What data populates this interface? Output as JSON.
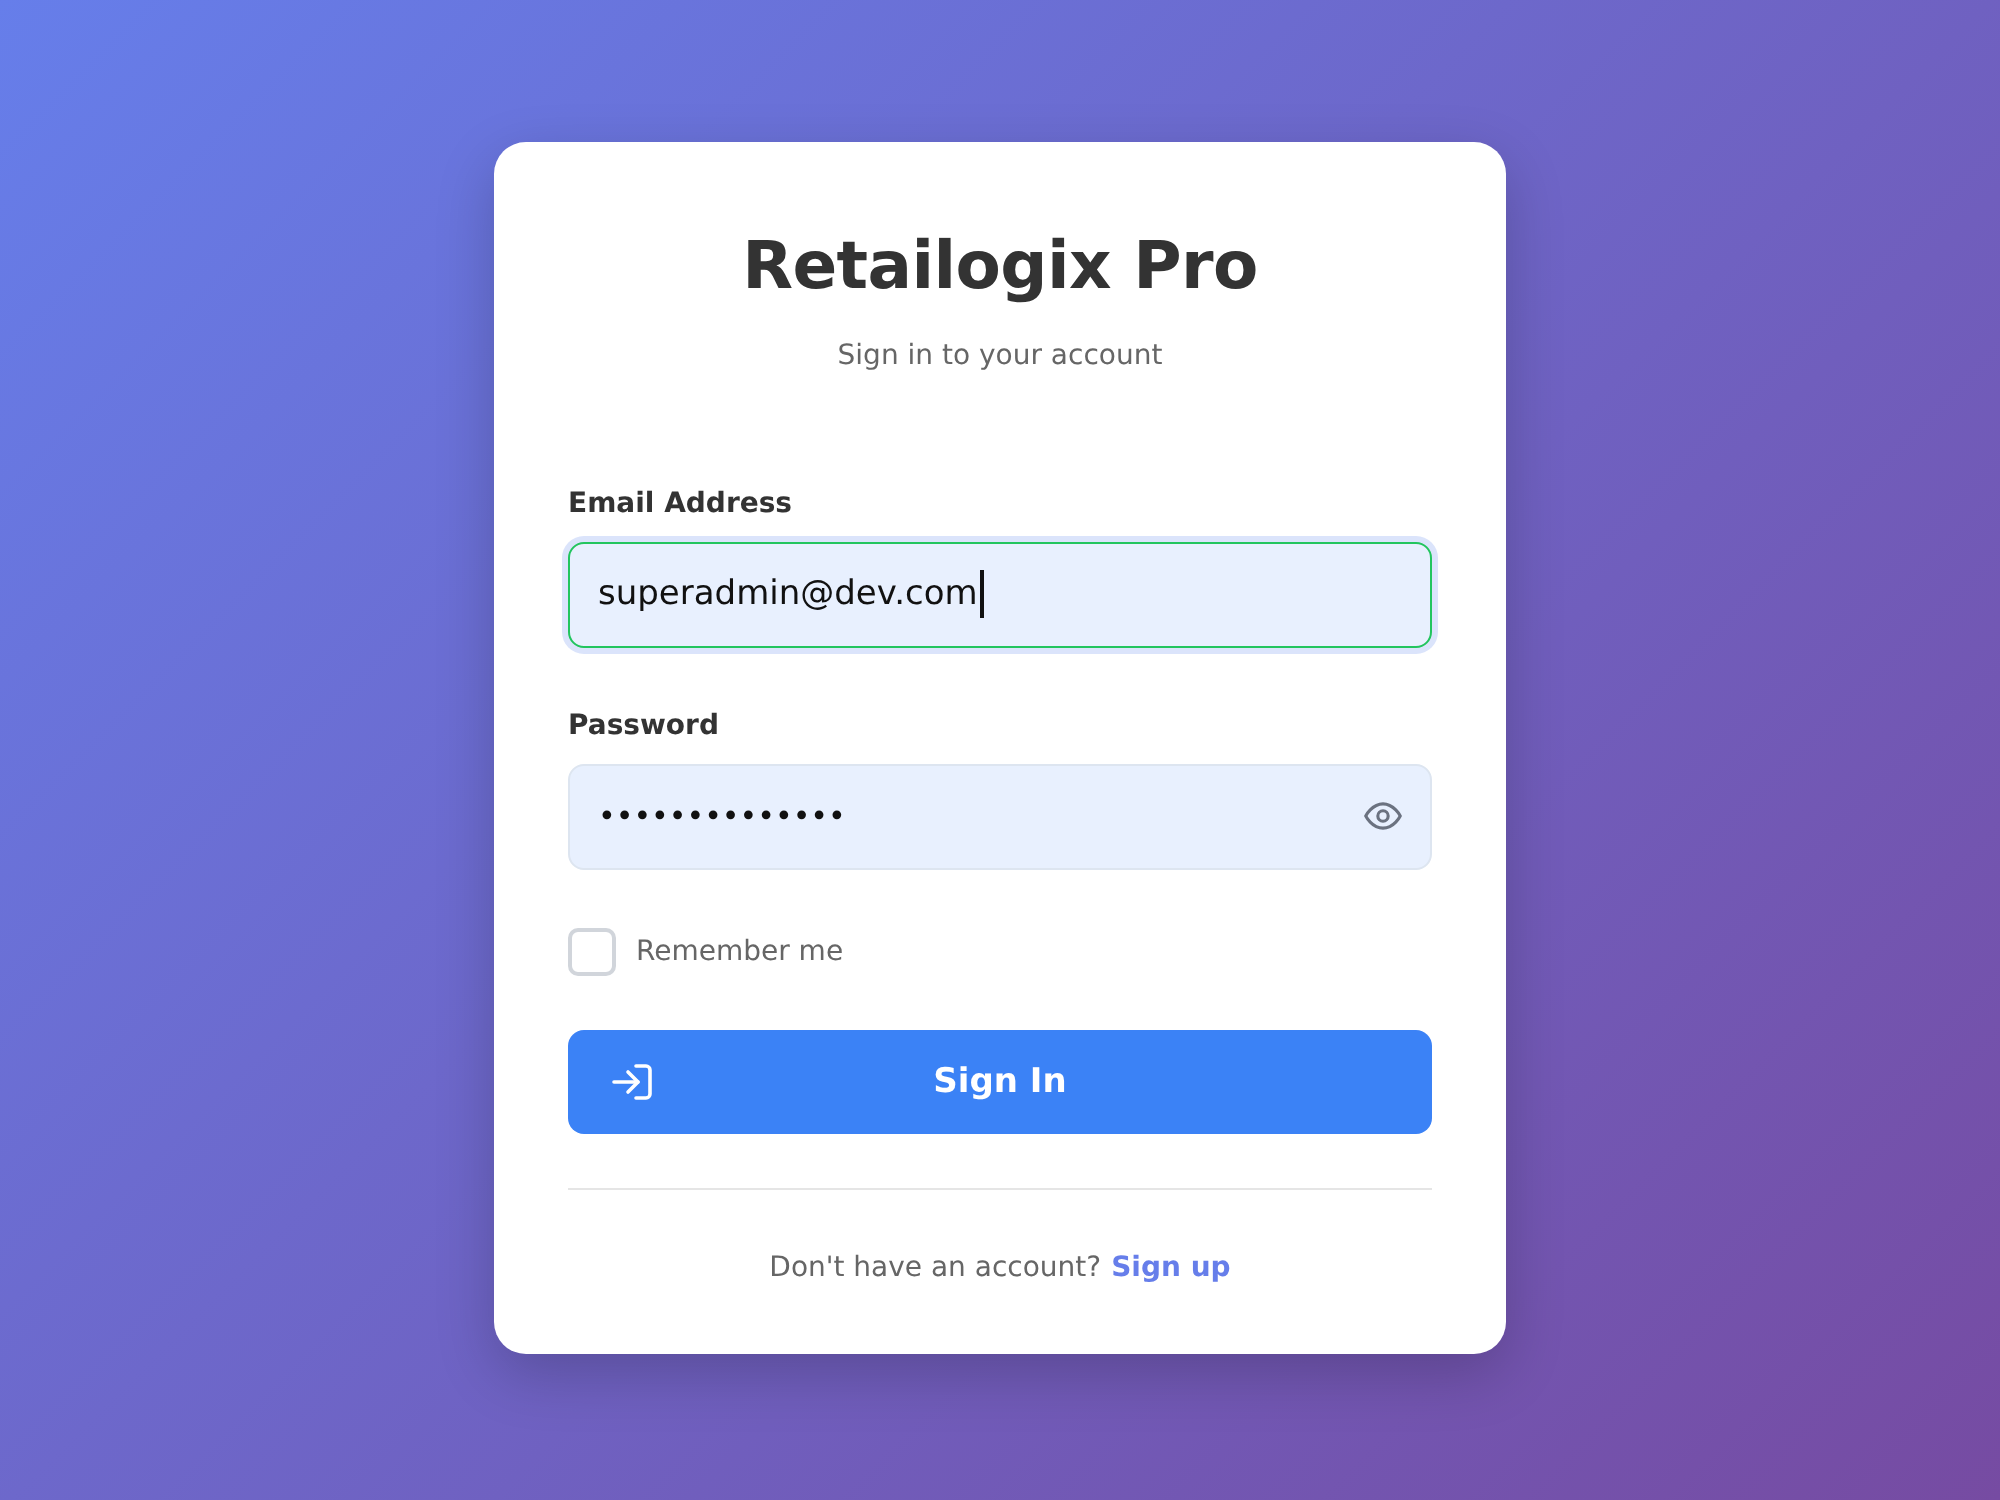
{
  "header": {
    "title": "Retailogix Pro",
    "subtitle": "Sign in to your account"
  },
  "fields": [
    {
      "kind": "email",
      "label": "Email Address",
      "value": "superadmin@dev.com",
      "focused": true
    },
    {
      "kind": "password",
      "label": "Password",
      "value": "••••••••••••••",
      "focused": false
    }
  ],
  "remember": {
    "label": "Remember me",
    "checked": false
  },
  "submit": {
    "label": "Sign In"
  },
  "footer": {
    "text": "Don't have an account?",
    "link": "Sign up"
  }
}
